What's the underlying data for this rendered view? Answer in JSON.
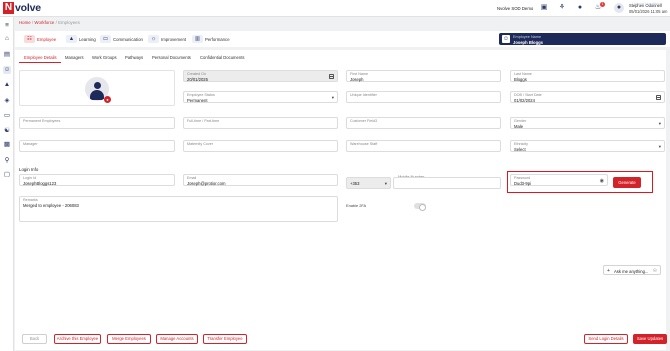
{
  "app": {
    "logo_initial": "N",
    "logo_rest": "volve"
  },
  "topbar": {
    "environment": "Nvolve SOD Demo",
    "notification_count": "1",
    "user_name": "Stephen Odonnell",
    "user_datetime": "05/01/2026 11:05 am"
  },
  "breadcrumb": {
    "home": "Home",
    "sep": "/",
    "workforce": "Workforce",
    "current": "Employees"
  },
  "main_tabs": [
    {
      "label": "Employee",
      "icon": "person-card-icon"
    },
    {
      "label": "Learning",
      "icon": "graduation-icon"
    },
    {
      "label": "Communication",
      "icon": "chat-icon"
    },
    {
      "label": "Improvement",
      "icon": "lightbulb-icon"
    },
    {
      "label": "Performance",
      "icon": "chart-icon"
    }
  ],
  "employee_card": {
    "name_label": "Employee Name",
    "name": "Joseph Bloggs",
    "uid_label": "Unique Identifier"
  },
  "sub_tabs": [
    "Employee Details",
    "Managers",
    "Work Groups",
    "Pathways",
    "Personal Documents",
    "Confidential Documents"
  ],
  "fields": {
    "created_on": {
      "label": "Created On",
      "value": "20/01/2025"
    },
    "first_name": {
      "label": "First Name",
      "value": "Joseph"
    },
    "last_name": {
      "label": "Last Name",
      "value": "Bloggs"
    },
    "employee_status": {
      "label": "Employee Status",
      "value": "Permanent"
    },
    "unique_identifier": {
      "label": "Unique Identifier",
      "value": ""
    },
    "dob": {
      "label": "DOB / Start Date",
      "value": "01/02/2024"
    },
    "permanent_employees": {
      "label": "Permanent Employees",
      "value": ""
    },
    "full_time": {
      "label": "Full-time / Part-time",
      "value": ""
    },
    "customer_field3": {
      "label": "Customer Field3",
      "value": ""
    },
    "gender": {
      "label": "Gender",
      "value": "Male"
    },
    "manager": {
      "label": "Manager",
      "value": ""
    },
    "maternity_cover": {
      "label": "Maternity Cover",
      "value": ""
    },
    "warehouse_staff": {
      "label": "Warehouse Staff",
      "value": ""
    },
    "ethnicity": {
      "label": "Ethnicity",
      "value": "Select"
    }
  },
  "login": {
    "section_title": "Login Info",
    "login_id_label": "Login Id",
    "login_id_value": "JosephBloggs123",
    "email_label": "Email",
    "email_value": "Joseph@protior.com",
    "country_code": "+353",
    "mobile_label": "Mobile Number",
    "mobile_value": "",
    "password_label": "Password",
    "password_value": "Dud3-9pi",
    "generate_label": "Generate",
    "remarks_label": "Remarks",
    "remarks_value": "Merged to employee - 206083",
    "enable_2fa_label": "Enable 2FA",
    "enable_2fa_on": false
  },
  "ask_widget": {
    "label": "Ask me anything..."
  },
  "footer": {
    "back": "Back",
    "archive": "Archive this Employee",
    "merge": "Merge Employees",
    "manage_accounts": "Manage Accounts",
    "transfer": "Transfer Employee",
    "send_login": "Send Login Details",
    "save": "Save Updates"
  },
  "colors": {
    "brand_red": "#d2232a",
    "brand_navy": "#1e2a5a",
    "highlight_red": "#e0161e"
  }
}
